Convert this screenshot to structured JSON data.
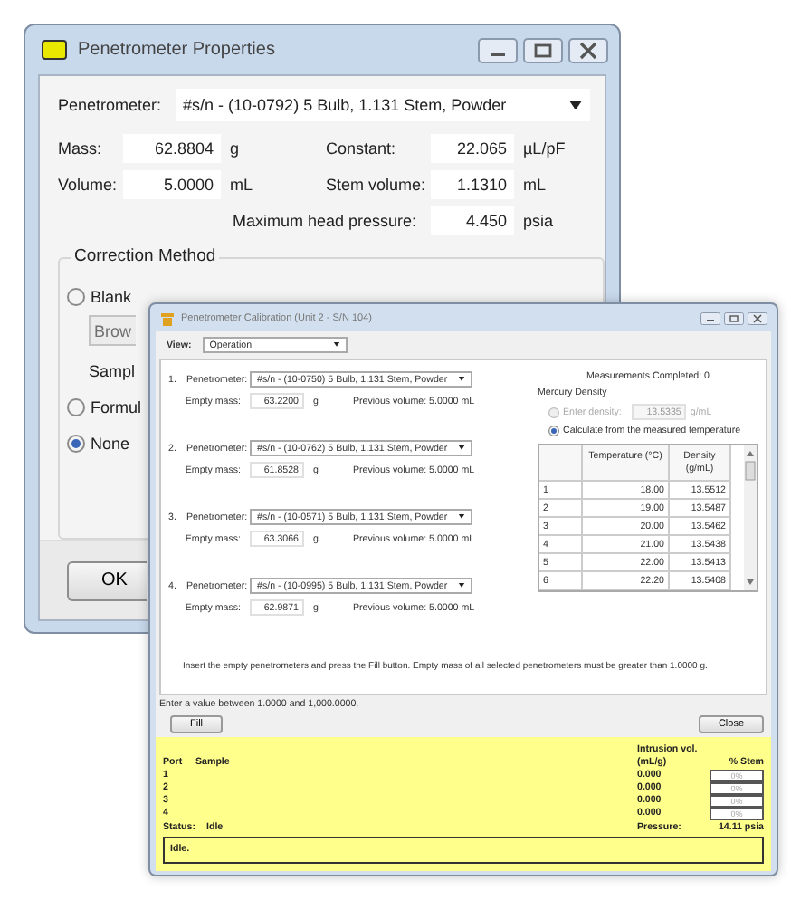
{
  "properties_window": {
    "title": "Penetrometer Properties",
    "penetrometer": {
      "label": "Penetrometer:",
      "value": "#s/n - (10-0792)  5 Bulb, 1.131 Stem, Powder"
    },
    "fields": [
      {
        "label": "Mass:",
        "value": "62.8804",
        "unit": "g"
      },
      {
        "label": "Constant:",
        "value": "22.065",
        "unit": "µL/pF"
      },
      {
        "label": "Volume:",
        "value": "5.0000",
        "unit": "mL"
      },
      {
        "label": "Stem volume:",
        "value": "1.1310",
        "unit": "mL"
      },
      {
        "label": "Maximum head pressure:",
        "value": "4.450",
        "unit": "psia"
      }
    ],
    "correction_method": {
      "title": "Correction Method",
      "browse_button": "Brow",
      "sample_label": "Sampl",
      "options": [
        {
          "label": "Blank",
          "selected": false
        },
        {
          "label": "Formul",
          "selected": false
        },
        {
          "label": "None",
          "selected": true
        }
      ]
    },
    "ok_button": "OK"
  },
  "calibration_window": {
    "title": "Penetrometer Calibration (Unit 2 - S/N 104)",
    "view": {
      "label": "View:",
      "value": "Operation"
    },
    "penetrometers": [
      {
        "number": "1.",
        "label": "Penetrometer:",
        "value": "#s/n - (10-0750)  5 Bulb, 1.131 Stem, Powder",
        "mass_label": "Empty mass:",
        "mass": "63.2200",
        "unit": "g",
        "previous_volume": "Previous volume:  5.0000 mL"
      },
      {
        "number": "2.",
        "label": "Penetrometer:",
        "value": "#s/n - (10-0762)  5 Bulb, 1.131 Stem, Powder",
        "mass_label": "Empty mass:",
        "mass": "61.8528",
        "unit": "g",
        "previous_volume": "Previous volume:  5.0000 mL"
      },
      {
        "number": "3.",
        "label": "Penetrometer:",
        "value": "#s/n - (10-0571)  5 Bulb, 1.131 Stem, Powder",
        "mass_label": "Empty mass:",
        "mass": "63.3066",
        "unit": "g",
        "previous_volume": "Previous volume:  5.0000 mL"
      },
      {
        "number": "4.",
        "label": "Penetrometer:",
        "value": "#s/n - (10-0995)  5 Bulb, 1.131 Stem, Powder",
        "mass_label": "Empty mass:",
        "mass": "62.9871",
        "unit": "g",
        "previous_volume": "Previous volume:  5.0000 mL"
      }
    ],
    "measurements_completed": "Measurements Completed: 0",
    "mercury_density": {
      "title": "Mercury Density",
      "options": [
        {
          "kind": "entry",
          "label": "Enter density:",
          "value": "13.5335",
          "unit": "g/mL",
          "selected": false,
          "disabled": true
        },
        {
          "kind": "plain",
          "label": "Calculate from the measured temperature",
          "selected": true,
          "disabled": false
        }
      ],
      "table": {
        "columns": [
          "",
          "Temperature (°C)",
          "Density (g/mL)"
        ],
        "rows": [
          [
            "1",
            "18.00",
            "13.5512"
          ],
          [
            "2",
            "19.00",
            "13.5487"
          ],
          [
            "3",
            "20.00",
            "13.5462"
          ],
          [
            "4",
            "21.00",
            "13.5438"
          ],
          [
            "5",
            "22.00",
            "13.5413"
          ],
          [
            "6",
            "22.20",
            "13.5408"
          ]
        ]
      }
    },
    "instruction": "Insert the empty penetrometers and press the Fill button. Empty mass of all selected penetrometers must be greater than 1.0000 g.",
    "status_message": "Enter a value between 1.0000 and 1,000.0000.",
    "buttons": [
      "Fill",
      "Close"
    ],
    "status_panel": {
      "columns": [
        "Port",
        "Sample",
        "Intrusion vol. (mL/g)",
        "% Stem"
      ],
      "ports": [
        {
          "port": "1",
          "intrusion": "0.000",
          "stem": "0%",
          "level": 0
        },
        {
          "port": "2",
          "intrusion": "0.000",
          "stem": "0%",
          "level": 0
        },
        {
          "port": "3",
          "intrusion": "0.000",
          "stem": "0%",
          "level": 0
        },
        {
          "port": "4",
          "intrusion": "0.000",
          "stem": "0%",
          "level": 0
        }
      ],
      "status_label": "Status:",
      "status": "Idle",
      "pressure_label": "Pressure:",
      "pressure": "14.11 psia",
      "log": "Idle."
    }
  }
}
